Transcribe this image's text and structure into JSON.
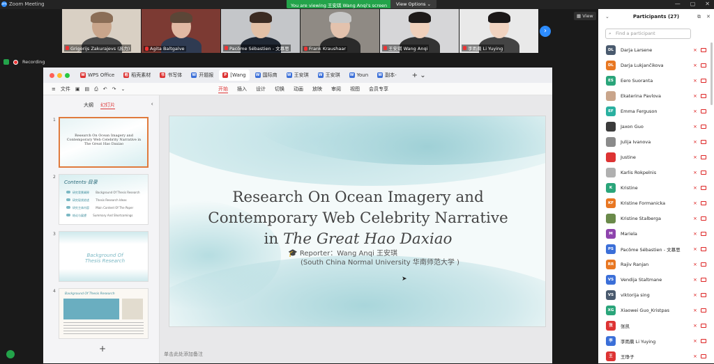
{
  "window": {
    "title": "Zoom Meeting",
    "logo_text": "zm",
    "controls": [
      "—",
      "▢",
      "✕"
    ]
  },
  "banner": {
    "viewing": "You are viewing 王安琪 Wang Anqi's screen",
    "view_options": "View Options ⌄"
  },
  "view_button": "▦ View",
  "recording": "Recording",
  "participants_strip": [
    {
      "name": "Grigorijs Zakurajevs (高力)",
      "bg": "#d9d0c4",
      "skin": "#c9a58b",
      "shirt": "#4a4a4a",
      "hair": "#8b6e57"
    },
    {
      "name": "Agita Baltgalve",
      "bg": "#7c3a33",
      "skin": "#e0b9a3",
      "shirt": "#2f3b52",
      "hair": "#5b4637"
    },
    {
      "name": "Pacôme Sébastien - 文慕思",
      "bg": "#c4c6c9",
      "skin": "#e2c0a6",
      "shirt": "#1f2733",
      "hair": "#3b2b22"
    },
    {
      "name": "Frank Kraushaar",
      "bg": "#8f8a84",
      "skin": "#e3c2ad",
      "shirt": "#2a2a2a",
      "hair": "#c7c7c7"
    },
    {
      "name": "王安琪 Wang Anqi",
      "bg": "#d6d6d8",
      "skin": "#f0d0bb",
      "shirt": "#333",
      "hair": "#1e1a19"
    },
    {
      "name": "李雨晨 Li Yuying",
      "bg": "#e9e9e9",
      "skin": "#f1d3c0",
      "shirt": "#444",
      "hair": "#1b1717"
    }
  ],
  "app": {
    "tabs": [
      {
        "label": "WPS Office",
        "color": "#d33",
        "glyph": "W"
      },
      {
        "label": "稻壳素材",
        "color": "#d33",
        "glyph": "稻"
      },
      {
        "label": "书写体",
        "color": "#d33",
        "glyph": "书"
      },
      {
        "label": "开题报",
        "color": "#3b6fd8",
        "glyph": "W"
      },
      {
        "label": "[Wang",
        "color": "#d33",
        "glyph": "P"
      },
      {
        "label": "国际商",
        "color": "#3b6fd8",
        "glyph": "W"
      },
      {
        "label": "王安琪",
        "color": "#3b6fd8",
        "glyph": "W"
      },
      {
        "label": "王安琪",
        "color": "#3b6fd8",
        "glyph": "W"
      },
      {
        "label": "Youn",
        "color": "#3b6fd8",
        "glyph": "W"
      },
      {
        "label": "副本-",
        "color": "#3b6fd8",
        "glyph": "W"
      }
    ],
    "file_menu": "文件",
    "ribbon_tabs": [
      "开始",
      "插入",
      "设计",
      "切换",
      "动画",
      "放映",
      "审阅",
      "视图",
      "会员专享"
    ],
    "side_tabs": [
      "大纲",
      "幻灯片"
    ],
    "slide_numbers": [
      "1",
      "2",
      "3",
      "4"
    ],
    "thumb1_title": "Research On Ocean Imagery and Contemporary Web Celebrity Narrative in The Great Hao Daxiao",
    "thumb2_title": "Contents·目录",
    "thumb2_items": [
      "研究背景阐释",
      "研究现状综述",
      "研究主体内容",
      "结论与展望"
    ],
    "thumb2_en": [
      "Background Of Thesis Research",
      "Thesis Research Ideas",
      "Main Content Of The Paper",
      "Summary And Shortcomings"
    ],
    "thumb3_title": "Background Of Thesis Research",
    "thumb4_title": "Background Of Thesis Research",
    "notes": "单击此处添加备注"
  },
  "slide": {
    "title_line1": "Research On Ocean Imagery and",
    "title_line2": "Contemporary Web Celebrity Narrative",
    "title_line3_prefix": "in ",
    "title_line3_italic": "The Great Hao Daxiao",
    "reporter": "Reporter：Wang Anqi 王安琪",
    "affiliation": "(South China Normal University 华南师范大学 )"
  },
  "panel": {
    "title": "Participants (27)",
    "search_placeholder": "Find a participant",
    "people": [
      {
        "initials": "DL",
        "name": "Darja Larsene",
        "color": "#4a5a6e"
      },
      {
        "initials": "DL",
        "name": "Darja Lukjančikova",
        "color": "#e87722"
      },
      {
        "initials": "ES",
        "name": "Eero Suoranta",
        "color": "#2aa57a"
      },
      {
        "initials": "",
        "name": "Ekaterina Pavlova",
        "color": "#c9a58b"
      },
      {
        "initials": "EF",
        "name": "Emma Ferguson",
        "color": "#2ab0a0"
      },
      {
        "initials": "",
        "name": "Jaxon Guo",
        "color": "#3b3b3b"
      },
      {
        "initials": "",
        "name": "Julija Ivanova",
        "color": "#8b8b8b"
      },
      {
        "initials": "",
        "name": "Justine",
        "color": "#d33"
      },
      {
        "initials": "",
        "name": "Karlis Rokpelnis",
        "color": "#b0b0b0"
      },
      {
        "initials": "K",
        "name": "Kristine",
        "color": "#2aa57a"
      },
      {
        "initials": "KF",
        "name": "Kristine Formanicka",
        "color": "#e87722"
      },
      {
        "initials": "",
        "name": "Kristine Stalberga",
        "color": "#6a8a4a"
      },
      {
        "initials": "M",
        "name": "Mariela",
        "color": "#8e44ad"
      },
      {
        "initials": "PS",
        "name": "Pacôme Sébastien - 文慕思",
        "color": "#3b6fd8"
      },
      {
        "initials": "RR",
        "name": "Rajiv Ranjan",
        "color": "#e87722"
      },
      {
        "initials": "VS",
        "name": "Vendija Staltmane",
        "color": "#3b6fd8"
      },
      {
        "initials": "VS",
        "name": "viktorija sing",
        "color": "#4a5a6e"
      },
      {
        "initials": "XG",
        "name": "Xiaowei Guo_Kristpas",
        "color": "#2aa57a"
      },
      {
        "initials": "张",
        "name": "张凯",
        "color": "#d33"
      },
      {
        "initials": "李",
        "name": "李雨晨 Li Yuying",
        "color": "#3b6fd8"
      },
      {
        "initials": "王",
        "name": "王琤子",
        "color": "#d33"
      }
    ]
  }
}
